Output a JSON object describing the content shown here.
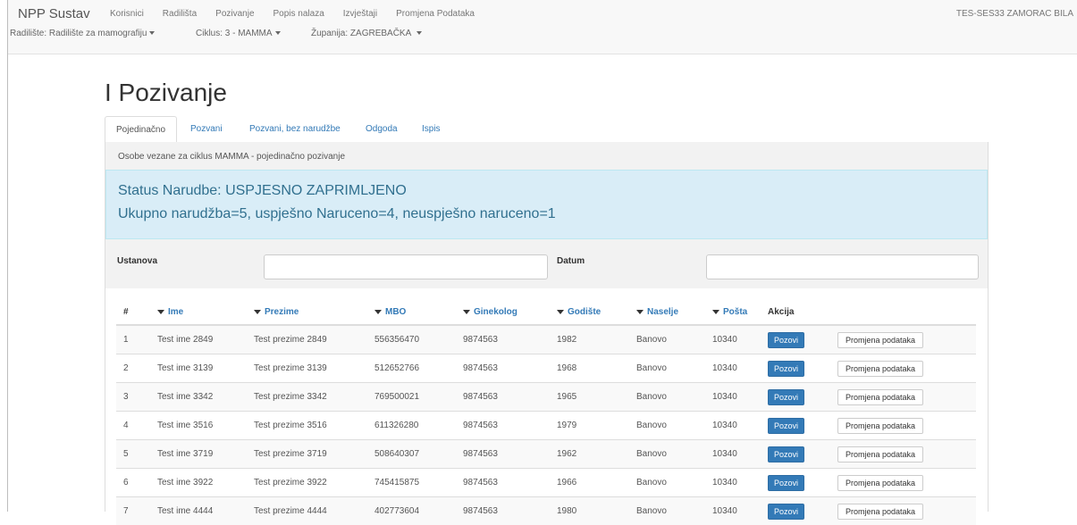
{
  "navbar": {
    "brand": "NPP Sustav",
    "menu": [
      "Korisnici",
      "Radilišta",
      "Pozivanje",
      "Popis nalaza",
      "Izvještaji",
      "Promjena Podataka"
    ],
    "user": "TES-SES33 ZAMORAC BILA",
    "context": {
      "radiliste": "Radilište: Radilište za mamografiju",
      "ciklus": "Ciklus: 3 - MAMMA",
      "zupanija": "Županija: ZAGREBAČKA"
    }
  },
  "page": {
    "title": "I Pozivanje"
  },
  "tabs": [
    "Pojedinačno",
    "Pozvani",
    "Pozvani, bez narudžbe",
    "Odgoda",
    "Ispis"
  ],
  "panel": {
    "subtitle": "Osobe vezane za ciklus MAMMA - pojedinačno pozivanje",
    "status_line": "Status Narudbe: USPJESNO ZAPRIMLJENO",
    "summary_line": "Ukupno narudžba=5, uspješno Naruceno=4, neuspješno naruceno=1"
  },
  "filters": {
    "ustanova_label": "Ustanova",
    "ustanova_value": "",
    "datum_label": "Datum",
    "datum_value": ""
  },
  "table": {
    "headers": [
      "#",
      "Ime",
      "Prezime",
      "MBO",
      "Ginekolog",
      "Godište",
      "Naselje",
      "Pošta",
      "Akcija"
    ],
    "call_label": "Pozovi",
    "edit_label": "Promjena podataka",
    "rows": [
      [
        "1",
        "Test ime 2849",
        "Test prezime 2849",
        "556356470",
        "9874563",
        "1982",
        "Banovo",
        "10340"
      ],
      [
        "2",
        "Test ime 3139",
        "Test prezime 3139",
        "512652766",
        "9874563",
        "1968",
        "Banovo",
        "10340"
      ],
      [
        "3",
        "Test ime 3342",
        "Test prezime 3342",
        "769500021",
        "9874563",
        "1965",
        "Banovo",
        "10340"
      ],
      [
        "4",
        "Test ime 3516",
        "Test prezime 3516",
        "611326280",
        "9874563",
        "1979",
        "Banovo",
        "10340"
      ],
      [
        "5",
        "Test ime 3719",
        "Test prezime 3719",
        "508640307",
        "9874563",
        "1962",
        "Banovo",
        "10340"
      ],
      [
        "6",
        "Test ime 3922",
        "Test prezime 3922",
        "745415875",
        "9874563",
        "1966",
        "Banovo",
        "10340"
      ],
      [
        "7",
        "Test ime 4444",
        "Test prezime 4444",
        "402773604",
        "9874563",
        "1980",
        "Banovo",
        "10340"
      ]
    ]
  }
}
